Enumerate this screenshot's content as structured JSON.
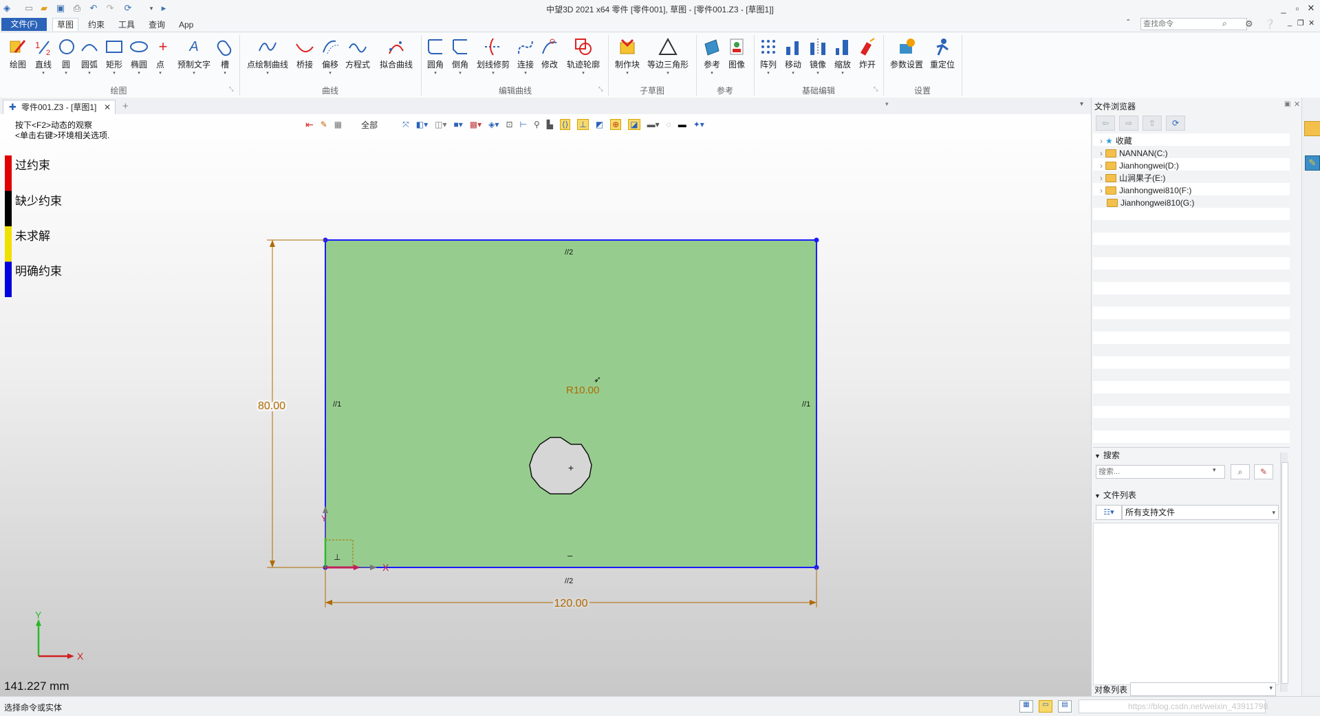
{
  "window": {
    "title": "中望3D 2021 x64        零件 [零件001], 草图 - [零件001.Z3 - [草图1]]"
  },
  "menubar": {
    "file": "文件(F)",
    "items": [
      "草图",
      "约束",
      "工具",
      "查询",
      "App"
    ]
  },
  "search_command": {
    "placeholder": "查找命令"
  },
  "ribbon": {
    "groups": [
      {
        "label": "绘图",
        "buttons": [
          "绘图",
          "直线",
          "圆",
          "圆弧",
          "矩形",
          "椭圆",
          "点",
          "预制文字",
          "槽"
        ]
      },
      {
        "label": "曲线",
        "buttons": [
          "点绘制曲线",
          "桥接",
          "偏移",
          "方程式",
          "拟合曲线"
        ]
      },
      {
        "label": "编辑曲线",
        "buttons": [
          "圆角",
          "倒角",
          "划线修剪",
          "连接",
          "修改",
          "轨迹轮廓"
        ]
      },
      {
        "label": "子草图",
        "buttons": [
          "制作块",
          "等边三角形"
        ]
      },
      {
        "label": "参考",
        "buttons": [
          "参考",
          "图像"
        ]
      },
      {
        "label": "基础编辑",
        "buttons": [
          "阵列",
          "移动",
          "镜像",
          "缩放",
          "炸开"
        ]
      },
      {
        "label": "设置",
        "buttons": [
          "参数设置",
          "重定位"
        ]
      }
    ]
  },
  "doc_tab": {
    "label": "零件001.Z3 - [草图1]"
  },
  "viewport": {
    "filter": "全部",
    "hints": [
      "按下<F2>动态的观察",
      "<单击右键>环境相关选项."
    ],
    "legend": [
      {
        "label": "过约束",
        "color": "#e00000"
      },
      {
        "label": "缺少约束",
        "color": "#000000"
      },
      {
        "label": "未求解",
        "color": "#f0e000"
      },
      {
        "label": "明确约束",
        "color": "#0000e0"
      }
    ],
    "unit_readout": "141.227 mm",
    "sketch": {
      "fill": "#96cd8e",
      "edge": "#1a1aff",
      "dim_width": "120.00",
      "dim_height": "80.00",
      "radius": "R10.00",
      "constraint_top": "//2",
      "constraint_bottom": "//2",
      "constraint_left": "//1",
      "constraint_right": "//1",
      "axis_x": "X",
      "axis_y": "Y"
    }
  },
  "file_browser": {
    "title": "文件浏览器",
    "tree": [
      "收藏",
      "NANNAN(C:)",
      "Jianhongwei(D:)",
      "山涧果子(E:)",
      "Jianhongwei810(F:)",
      "Jianhongwei810(G:)"
    ],
    "search_title": "搜索",
    "search_placeholder": "搜索...",
    "file_list_title": "文件列表",
    "file_filter": "所有支持文件",
    "object_list_label": "对象列表"
  },
  "statusbar": {
    "text": "选择命令或实体",
    "watermark": "https://blog.csdn.net/weixin_43911798"
  }
}
